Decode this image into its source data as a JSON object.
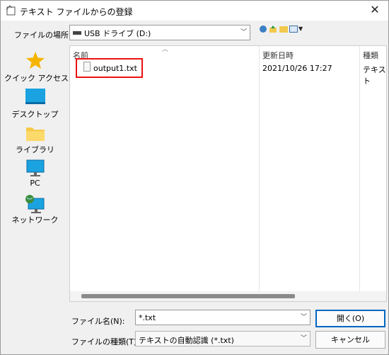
{
  "window": {
    "title": "テキスト ファイルからの登録",
    "close_glyph": "✕"
  },
  "location": {
    "label": "ファイルの場所(I):",
    "value": "USB ドライブ (D:)"
  },
  "toolbar": {
    "icons": [
      "back-icon",
      "up-folder-icon",
      "new-folder-icon",
      "view-menu-icon"
    ]
  },
  "places": [
    {
      "label": "クイック アクセス",
      "icon": "star-icon"
    },
    {
      "label": "デスクトップ",
      "icon": "desktop-icon"
    },
    {
      "label": "ライブラリ",
      "icon": "folder-icon"
    },
    {
      "label": "PC",
      "icon": "monitor-icon"
    },
    {
      "label": "ネットワーク",
      "icon": "network-icon"
    }
  ],
  "file_list": {
    "columns": [
      "名前",
      "更新日時",
      "種類"
    ],
    "rows": [
      {
        "name": "output1.txt",
        "modified": "2021/10/26 17:27",
        "type": "テキスト"
      }
    ]
  },
  "filename": {
    "label": "ファイル名(N):",
    "value": "*.txt"
  },
  "filetype": {
    "label": "ファイルの種類(T):",
    "value": "テキストの自動認識 (*.txt)"
  },
  "buttons": {
    "open": "開く(O)",
    "cancel": "キャンセル"
  },
  "colors": {
    "highlight": "#ee1111",
    "default_button": "#0067c0"
  }
}
